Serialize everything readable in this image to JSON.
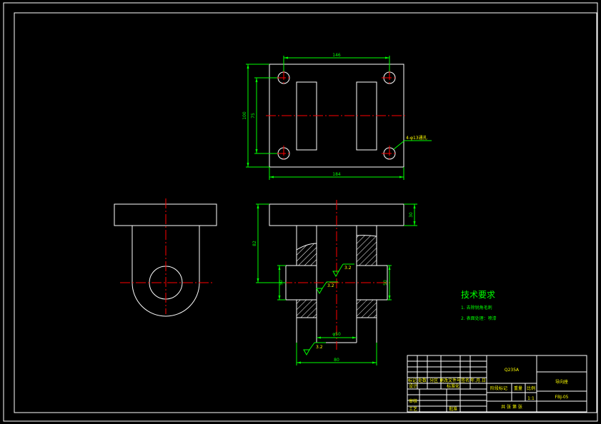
{
  "colors": {
    "background": "#000000",
    "outline": "#ffffff",
    "centerline": "#ff0000",
    "dimension": "#00ff00",
    "note_text": "#ffff00",
    "hatch": "#ffffff"
  },
  "top_view": {
    "dim_hole_spacing_x": "146",
    "dim_overall_height": "100",
    "dim_hole_spacing_y": "75",
    "dim_overall_width": "184",
    "hole_callout": "4-φ13通孔"
  },
  "front_view": {
    "dim_flange_thickness": "30",
    "dim_total_height": "82",
    "dim_bore_left": "50",
    "dim_bore_right": "50",
    "surface_finish_1": "3.2",
    "surface_finish_2": "3.2",
    "surface_finish_3": "3.2",
    "dim_bore_dia": "φ50",
    "dim_bottom_width": "80"
  },
  "notes": {
    "title": "技术要求",
    "item1": "1. 去除锐角毛刺",
    "item2": "2. 表面处理：喷漆"
  },
  "title_block": {
    "material": "Q235A",
    "part_name": "导向座",
    "drawing_no": "FBJ-05",
    "scale": "1:1",
    "label_mark": "标记",
    "label_count": "处数",
    "label_zone": "分区",
    "label_change_doc": "更改文件号",
    "label_signature": "签名",
    "label_date": "年.月.日",
    "label_design": "设计",
    "label_standardize": "标准化",
    "label_stage_mark": "阶段标记",
    "label_weight": "重量",
    "label_scale": "比例",
    "label_review": "审核",
    "label_process": "工艺",
    "label_approve": "批准",
    "label_sheets": "共 张 第 张"
  }
}
